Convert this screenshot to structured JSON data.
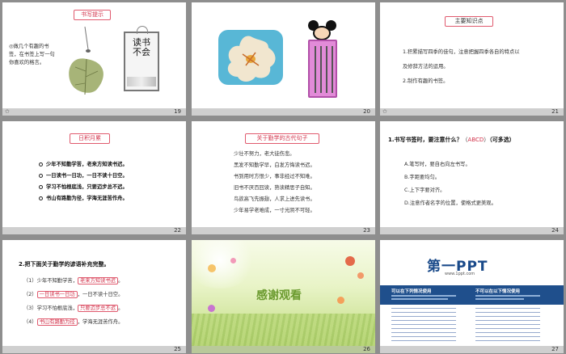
{
  "slide19": {
    "tag": "书写提示",
    "text": "◎做几个有趣的书签，在书签上写一句你喜欢的格言。",
    "card_text": "读书不会",
    "page": "19"
  },
  "slide20": {
    "page": "20"
  },
  "slide21": {
    "tag": "主要知识点",
    "items": [
      "1.积累描写四季的佳句，注意把握四季各自的特点以",
      "及修辞方法的运用。",
      "2.制作有趣的书签。"
    ],
    "page": "21"
  },
  "slide22": {
    "tag": "日积月累",
    "items": [
      "少年不知勤学苦，老来方知读书迟。",
      "一日读书一日功，一日不读十日空。",
      "学习不怕根底浅，只要迈步总不迟。",
      "书山有路勤为径，学海无涯苦作舟。"
    ],
    "page": "22"
  },
  "slide23": {
    "tag": "关于勤学的古代句子",
    "items": [
      "少壮不努力，老大徒伤悲。",
      "黑发不知勤学早，白发方悔读书迟。",
      "书到用时方恨少，事非经过不知难。",
      "旧书不厌百回读，熟读精思子自知。",
      "鸟欲高飞先振翅，人求上进先读书。",
      "少年易学老难成，一寸光阴不可轻。"
    ],
    "page": "23"
  },
  "slide24": {
    "question": "1.书写书签时，要注意什么？",
    "answer": "ABCD",
    "note": "（可多选）",
    "options": [
      "A.笔写时，要自右向左书写。",
      "B.字距要均匀。",
      "C.上下字要对齐。",
      "D.注意作者名字的位置，使格式更美观。"
    ],
    "page": "24"
  },
  "slide25": {
    "title": "2.把下面关于勤学的谚语补充完整。",
    "rows": [
      {
        "num": "（1）",
        "left": "少年不知勤学苦，",
        "fill": "老来方知读书迟",
        "right": "。"
      },
      {
        "num": "（2）",
        "left": "",
        "fill": "一日读书一日功",
        "right": "，一日不读十日空。"
      },
      {
        "num": "（3）",
        "left": "学习不怕根底浅，",
        "fill": "只要迈步总不迟",
        "right": "。"
      },
      {
        "num": "（4）",
        "left": "",
        "fill": "书山有路勤为径",
        "right": "，学海无涯苦作舟。"
      }
    ],
    "page": "25"
  },
  "slide26": {
    "title": "感谢观看",
    "page": "26"
  },
  "slide27": {
    "logo": "第一PPT",
    "url": "www.1ppt.com",
    "col_left": "可以在下列情况使用",
    "col_right": "不可以在以下情况使用",
    "page": "27"
  },
  "colors": {
    "accent": "#d2334b",
    "bar": "#cfcfcf"
  }
}
